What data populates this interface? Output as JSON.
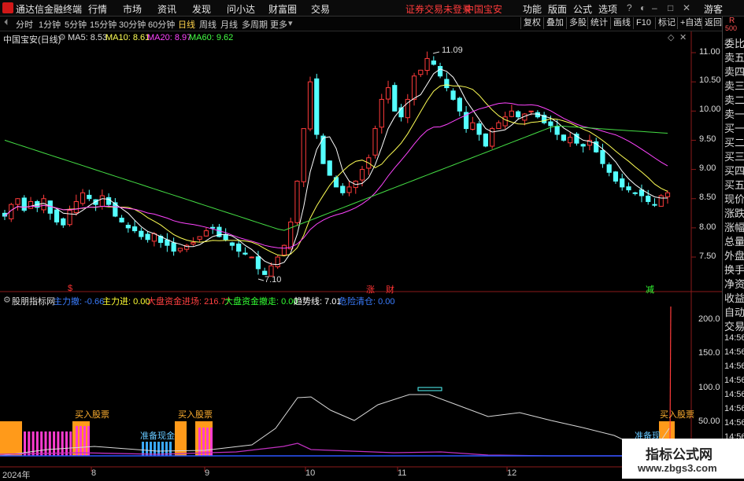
{
  "menu": {
    "app_title": "通达信金融终端",
    "items": [
      "行情",
      "市场",
      "资讯",
      "发现",
      "问小达",
      "财富圈",
      "交易"
    ],
    "warning": "证券交易未登录",
    "stock_name": "中国宝安",
    "right_items": [
      "功能",
      "版面",
      "公式",
      "选项"
    ],
    "user": "游客"
  },
  "timeframes": {
    "items": [
      "分时",
      "1分钟",
      "5分钟",
      "15分钟",
      "30分钟",
      "60分钟",
      "日线",
      "周线",
      "月线",
      "多周期",
      "更多"
    ],
    "active": "日线"
  },
  "toolbar_right": [
    "复权",
    "叠加",
    "多股",
    "统计",
    "画线",
    "F10",
    "标记",
    "+自选",
    "返回"
  ],
  "main_chart": {
    "title": "中国宝安(日线)",
    "ma_labels": [
      {
        "text": "MA5: 8.53",
        "color": "#ffffff"
      },
      {
        "text": "MA10: 8.61",
        "color": "#ffff55"
      },
      {
        "text": "MA20: 8.97",
        "color": "#ff44ff"
      },
      {
        "text": "MA60: 9.62",
        "color": "#44ff44"
      }
    ],
    "high_label": "11.09",
    "low_label": "7.10",
    "y_ticks": [
      "11.00",
      "10.50",
      "10.00",
      "9.50",
      "9.00",
      "8.50",
      "8.00",
      "7.50"
    ],
    "markers": [
      {
        "text": "$",
        "color": "#ff3333"
      },
      {
        "text": "涨",
        "color": "#ff3333"
      },
      {
        "text": "财",
        "color": "#ff3333"
      },
      {
        "text": "减",
        "color": "#33ff33"
      }
    ],
    "colors": {
      "up": "#ff3b3b",
      "down": "#54ffff",
      "ma5": "#ffffff",
      "ma10": "#ffff55",
      "ma20": "#ff44ff",
      "ma60": "#44dd44"
    }
  },
  "indicator": {
    "name": "股朋指标网",
    "items": [
      {
        "text": "主力撤: -0.66",
        "color": "#3a7dff"
      },
      {
        "text": "主力进: 0.00",
        "color": "#ffff33"
      },
      {
        "text": "大盘资金进场: 216.77",
        "color": "#ff4040"
      },
      {
        "text": "大盘资金撤走: 0.00",
        "color": "#33ff33"
      },
      {
        "text": "趋势线: 7.01",
        "color": "#ffffff"
      },
      {
        "text": "危险清仓: 0.00",
        "color": "#3a7dff"
      }
    ],
    "y_ticks": [
      "200.0",
      "150.0",
      "100.0",
      "50.00"
    ],
    "buy_label": "买入股票",
    "prepare_label": "准备现金",
    "prepare_label_cut": "准备现"
  },
  "x_axis": [
    "2024年",
    "8",
    "9",
    "10",
    "11",
    "12"
  ],
  "sidebar": {
    "top": "R",
    "top_sub": "500",
    "items": [
      "委比",
      "卖五",
      "卖四",
      "卖三",
      "卖二",
      "卖一",
      "买一",
      "买二",
      "买三",
      "买四",
      "买五",
      "现价",
      "涨跌",
      "涨幅",
      "总量",
      "外盘",
      "换手",
      "净资",
      "收益",
      "自动",
      "交易",
      "14:56",
      "14:56",
      "14:56",
      "14:56",
      "14:56",
      "14:56",
      "14:56",
      "14:56"
    ]
  },
  "watermark": {
    "title": "指标公式网",
    "url": "www.zbgs3.com"
  }
}
